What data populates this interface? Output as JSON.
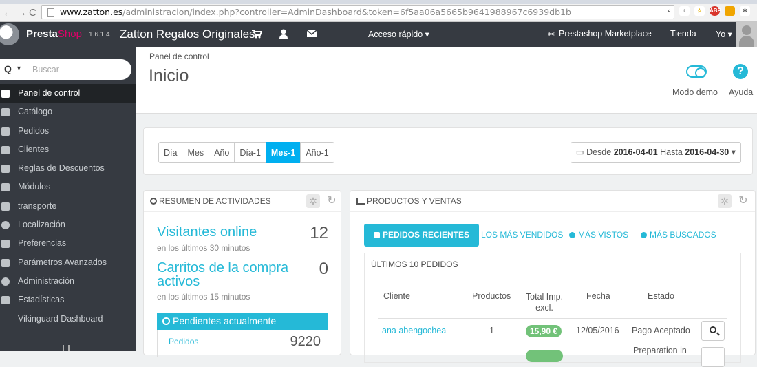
{
  "browser": {
    "url_host": "www.zatton.es",
    "url_path": "/administracion/index.php?controller=AdminDashboard&token=6f5aa06a5665b9641988967c6939db1b"
  },
  "topbar": {
    "brand_presta": "Presta",
    "brand_shop": "Shop",
    "version": "1.6.1.4",
    "shop_name": "Zatton Regalos Originales",
    "quick_access": "Acceso rápido ▾",
    "marketplace": "Prestashop Marketplace",
    "store": "Tienda",
    "me": "Yo ▾"
  },
  "sidebar": {
    "search_placeholder": "Buscar",
    "items": [
      {
        "label": "Panel de control",
        "active": true,
        "icon": "dashboard-icon"
      },
      {
        "label": "Catálogo",
        "icon": "book-icon"
      },
      {
        "label": "Pedidos",
        "icon": "credit-card-icon"
      },
      {
        "label": "Clientes",
        "icon": "users-icon"
      },
      {
        "label": "Reglas de Descuentos",
        "icon": "tag-icon"
      },
      {
        "label": "Módulos",
        "icon": "puzzle-icon"
      },
      {
        "label": "transporte",
        "icon": "truck-icon"
      },
      {
        "label": "Localización",
        "icon": "globe-icon"
      },
      {
        "label": "Preferencias",
        "icon": "wrench-icon"
      },
      {
        "label": "Parámetros Avanzados",
        "icon": "cogs-icon"
      },
      {
        "label": "Administración",
        "icon": "cog-icon"
      },
      {
        "label": "Estadísticas",
        "icon": "bar-chart-icon"
      },
      {
        "label": "Vikinguard Dashboard",
        "icon": ""
      }
    ]
  },
  "header": {
    "breadcrumb": "Panel de control",
    "title": "Inicio",
    "demo_mode": "Modo demo",
    "help": "Ayuda"
  },
  "datebar": {
    "buttons": [
      "Día",
      "Mes",
      "Año",
      "Día-1",
      "Mes-1",
      "Año-1"
    ],
    "active_button": "Mes-1",
    "range_from_label": "Desde",
    "range_from": "2016-04-01",
    "range_to_label": "Hasta",
    "range_to": "2016-04-30"
  },
  "activity": {
    "title": "RESUMEN DE ACTIVIDADES",
    "online_label": "Visitantes online",
    "online_sub": "en los últimos 30 minutos",
    "online_value": "12",
    "carts_label": "Carritos de la compra activos",
    "carts_sub": "en los últimos 15 minutos",
    "carts_value": "0",
    "pending_title": "Pendientes actualmente",
    "pending_orders_label": "Pedidos",
    "pending_orders_value": "9220"
  },
  "products": {
    "title": "PRODUCTOS Y VENTAS",
    "tabs": [
      "PEDIDOS RECIENTES",
      "LOS MÁS VENDIDOS",
      "MÁS VISTOS",
      "MÁS BUSCADOS"
    ],
    "orders_title": "ÚLTIMOS 10 PEDIDOS",
    "columns": [
      "Cliente",
      "Productos",
      "Total Imp. excl.",
      "Fecha",
      "Estado"
    ],
    "rows": [
      {
        "client": "ana abengochea",
        "products": "1",
        "total": "15,90 €",
        "date": "12/05/2016",
        "status": "Pago Aceptado"
      },
      {
        "client": "",
        "products": "",
        "total": "",
        "date": "",
        "status": "Preparation in"
      }
    ]
  }
}
